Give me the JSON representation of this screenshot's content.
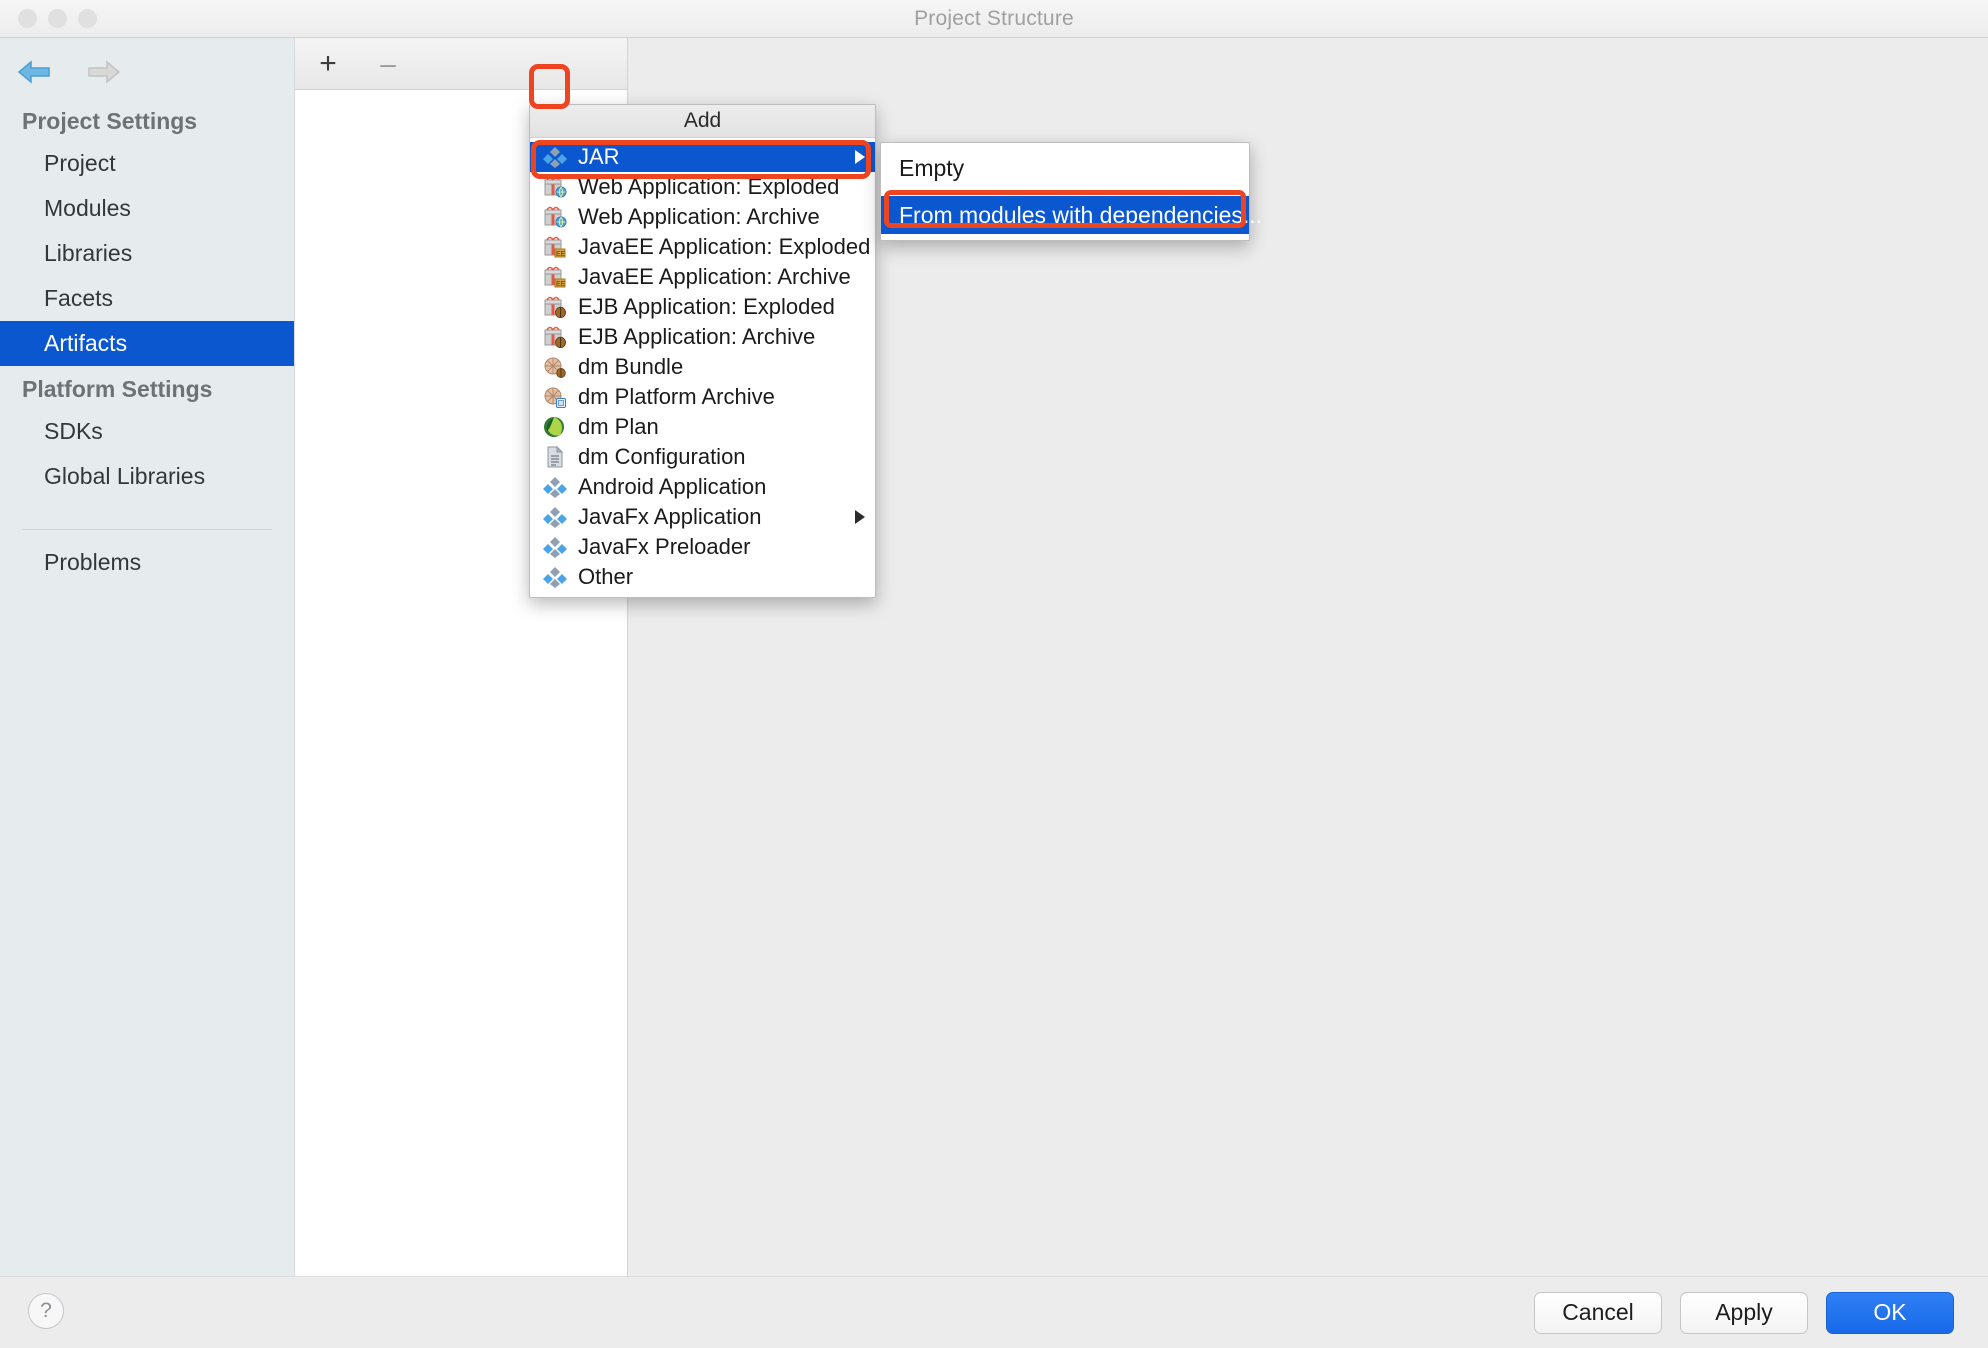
{
  "window": {
    "title": "Project Structure",
    "traffic_lights": [
      "close",
      "minimize",
      "zoom"
    ]
  },
  "nav": {
    "back_icon": "arrow-left-icon",
    "forward_icon": "arrow-right-icon"
  },
  "sidebar": {
    "groups": [
      {
        "label": "Project Settings",
        "items": [
          {
            "label": "Project",
            "selected": false
          },
          {
            "label": "Modules",
            "selected": false
          },
          {
            "label": "Libraries",
            "selected": false
          },
          {
            "label": "Facets",
            "selected": false
          },
          {
            "label": "Artifacts",
            "selected": true
          }
        ]
      },
      {
        "label": "Platform Settings",
        "items": [
          {
            "label": "SDKs",
            "selected": false
          },
          {
            "label": "Global Libraries",
            "selected": false
          }
        ]
      }
    ],
    "problems_label": "Problems"
  },
  "toolbar": {
    "add_label": "+",
    "remove_label": "–"
  },
  "add_menu": {
    "header": "Add",
    "items": [
      {
        "label": "JAR",
        "icon": "jar-diamonds-icon",
        "highlighted": true,
        "has_submenu": true
      },
      {
        "label": "Web Application: Exploded",
        "icon": "web-app-exploded-icon",
        "highlighted": false,
        "has_submenu": false
      },
      {
        "label": "Web Application: Archive",
        "icon": "web-app-archive-icon",
        "highlighted": false,
        "has_submenu": false
      },
      {
        "label": "JavaEE Application: Exploded",
        "icon": "javaee-exploded-icon",
        "highlighted": false,
        "has_submenu": false
      },
      {
        "label": "JavaEE Application: Archive",
        "icon": "javaee-archive-icon",
        "highlighted": false,
        "has_submenu": false
      },
      {
        "label": "EJB Application: Exploded",
        "icon": "ejb-exploded-icon",
        "highlighted": false,
        "has_submenu": false
      },
      {
        "label": "EJB Application: Archive",
        "icon": "ejb-archive-icon",
        "highlighted": false,
        "has_submenu": false
      },
      {
        "label": "dm Bundle",
        "icon": "dm-bundle-icon",
        "highlighted": false,
        "has_submenu": false
      },
      {
        "label": "dm Platform Archive",
        "icon": "dm-platform-archive-icon",
        "highlighted": false,
        "has_submenu": false
      },
      {
        "label": "dm Plan",
        "icon": "dm-plan-leaf-icon",
        "highlighted": false,
        "has_submenu": false
      },
      {
        "label": "dm Configuration",
        "icon": "dm-configuration-document-icon",
        "highlighted": false,
        "has_submenu": false
      },
      {
        "label": "Android Application",
        "icon": "android-diamonds-icon",
        "highlighted": false,
        "has_submenu": false
      },
      {
        "label": "JavaFx Application",
        "icon": "javafx-diamonds-icon",
        "highlighted": false,
        "has_submenu": true
      },
      {
        "label": "JavaFx Preloader",
        "icon": "javafx-preloader-diamonds-icon",
        "highlighted": false,
        "has_submenu": false
      },
      {
        "label": "Other",
        "icon": "other-diamonds-icon",
        "highlighted": false,
        "has_submenu": false
      }
    ]
  },
  "jar_submenu": {
    "items": [
      {
        "label": "Empty",
        "highlighted": false
      },
      {
        "label": "From modules with dependencies...",
        "highlighted": true
      }
    ]
  },
  "footer": {
    "help_label": "?",
    "buttons": [
      {
        "label": "Cancel",
        "primary": false
      },
      {
        "label": "Apply",
        "primary": false
      },
      {
        "label": "OK",
        "primary": true
      }
    ]
  },
  "colors": {
    "selection_blue": "#0b57d0",
    "annotation_red": "#ef4420",
    "sidebar_bg": "#e6ebee",
    "window_bg": "#ececec"
  }
}
